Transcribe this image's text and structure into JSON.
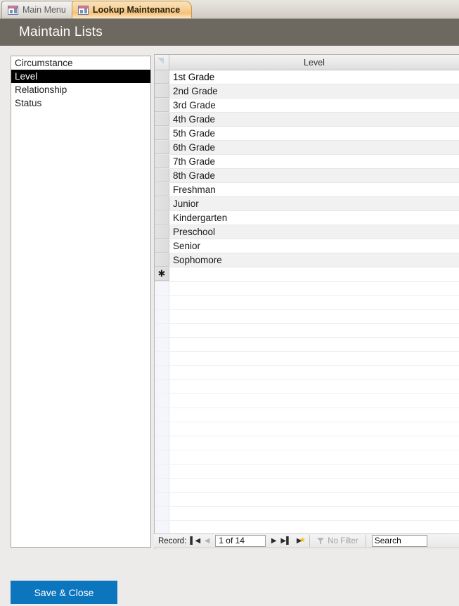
{
  "tabs": [
    {
      "label": "Main Menu",
      "active": false,
      "icon": "form-icon"
    },
    {
      "label": "Lookup Maintenance",
      "active": true,
      "icon": "form-icon"
    }
  ],
  "header": {
    "title": "Maintain Lists"
  },
  "lookup_list": {
    "items": [
      {
        "label": "Circumstance",
        "selected": false
      },
      {
        "label": "Level",
        "selected": true
      },
      {
        "label": "Relationship",
        "selected": false
      },
      {
        "label": "Status",
        "selected": false
      }
    ]
  },
  "datasheet": {
    "column_header": "Level",
    "new_record_marker": "✱",
    "rows": [
      "1st Grade",
      "2nd Grade",
      "3rd Grade",
      "4th Grade",
      "5th Grade",
      "6th Grade",
      "7th Grade",
      "8th Grade",
      "Freshman",
      "Junior",
      "Kindergarten",
      "Preschool",
      "Senior",
      "Sophomore"
    ]
  },
  "navigation": {
    "record_label": "Record:",
    "first_icon": "▌◀",
    "prev_icon": "◀",
    "position": "1 of 14",
    "next_icon": "▶",
    "last_icon": "▶▌",
    "new_icon": "▶",
    "filter_label": "No Filter",
    "filter_icon": "filter-funnel-icon",
    "search_value": "Search"
  },
  "actions": {
    "save_close_label": "Save & Close"
  },
  "colors": {
    "accent_blue": "#0b76be",
    "header_bar": "#6e6960",
    "active_tab": "#f5c17a",
    "selected_row": "#000000"
  }
}
